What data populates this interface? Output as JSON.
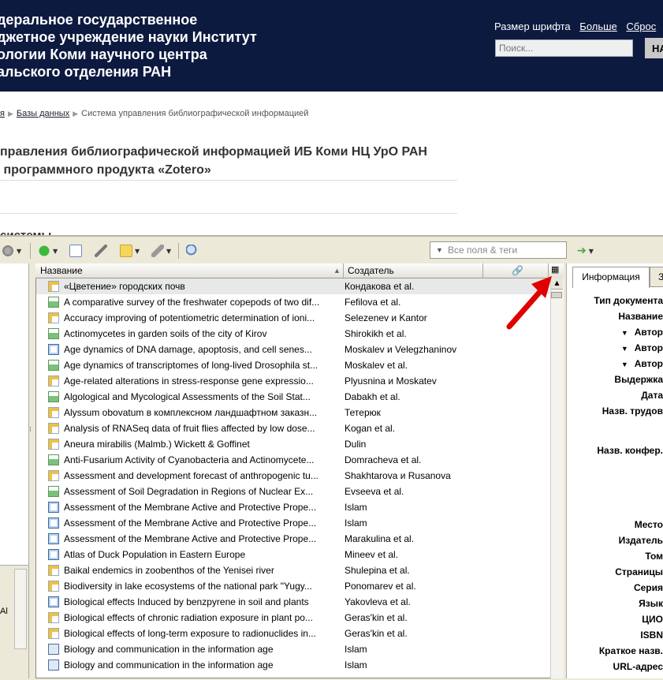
{
  "header": {
    "org_name": "деральное государственное\nджетное учреждение науки Институт\nологии Коми научного центра\nальского отделения РАН",
    "font_size_label": "Размер шрифта",
    "font_larger": "Больше",
    "font_reset": "Сброс",
    "search_placeholder": "Поиск...",
    "search_button": "НА"
  },
  "breadcrumbs": {
    "item1": "я",
    "item2": "Базы данных",
    "current": "Система управления библиографической информацией"
  },
  "page_title": "правления библиографической информацией ИБ Коми НЦ УрО РАН\n программного продукта «Zotero»",
  "section_heading": "системы",
  "toolbar": {
    "filter_placeholder": "Все поля & теги"
  },
  "columns": {
    "title": "Название",
    "creator": "Создатель"
  },
  "items": [
    {
      "title": "«Цветение» городских почв",
      "creator": "Кондакова et al.",
      "type": "article"
    },
    {
      "title": "A comparative survey of the freshwater copepods of two dif...",
      "creator": "Fefilova et al.",
      "type": "report"
    },
    {
      "title": "Accuracy improving of potentiometric determination of ioni...",
      "creator": "Selezenev и Kantor",
      "type": "article"
    },
    {
      "title": "Actinomycetes in garden soils of the city of Kirov",
      "creator": "Shirokikh et al.",
      "type": "report"
    },
    {
      "title": "Age dynamics of DNA damage, apoptosis, and cell senes...",
      "creator": "Moskalev и Velegzhaninov",
      "type": "book"
    },
    {
      "title": "Age dynamics of transcriptomes of long-lived Drosophila st...",
      "creator": "Moskalev et al.",
      "type": "report"
    },
    {
      "title": "Age-related alterations in stress-response gene expressio...",
      "creator": "Plyusnina и Moskatev",
      "type": "article"
    },
    {
      "title": "Algological and Mycological Assessments of the Soil Stat...",
      "creator": "Dabakh et al.",
      "type": "report"
    },
    {
      "title": "Alyssum obovatum в комплексном ландшафтном заказн...",
      "creator": "Тетерюк",
      "type": "article"
    },
    {
      "title": "Analysis of RNASeq data of fruit flies affected by low dose...",
      "creator": "Kogan et al.",
      "type": "article"
    },
    {
      "title": "Aneura mirabilis (Malmb.) Wickett & Goffinet",
      "creator": "Dulin",
      "type": "article"
    },
    {
      "title": "Anti-Fusarium Activity of Cyanobacteria and Actinomycete...",
      "creator": "Domracheva et al.",
      "type": "report"
    },
    {
      "title": "Assessment and development forecast of anthropogenic tu...",
      "creator": "Shakhtarova и Rusanova",
      "type": "article"
    },
    {
      "title": "Assessment of Soil Degradation in Regions of Nuclear Ex...",
      "creator": "Evseeva et al.",
      "type": "report"
    },
    {
      "title": "Assessment of the Membrane Active and Protective Prope...",
      "creator": "Islam",
      "type": "book"
    },
    {
      "title": "Assessment of the Membrane Active and Protective Prope...",
      "creator": "Islam",
      "type": "book"
    },
    {
      "title": "Assessment of the Membrane Active and Protective Prope...",
      "creator": "Marakulina et al.",
      "type": "book"
    },
    {
      "title": "Atlas of Duck Population in Eastern Europe",
      "creator": "Mineev et al.",
      "type": "book"
    },
    {
      "title": "Baikal endemics in zoobenthos of the Yenisei river",
      "creator": "Shulepina et al.",
      "type": "article"
    },
    {
      "title": "Biodiversity in lake ecosystems of the national park \"Yugy...",
      "creator": "Ponomarev et al.",
      "type": "article"
    },
    {
      "title": "Biological effects Induced by benzpyrene in soil and plants",
      "creator": "Yakovleva et al.",
      "type": "book"
    },
    {
      "title": "Biological effects of chronic radiation exposure in plant po...",
      "creator": "Geras'kin et al.",
      "type": "article"
    },
    {
      "title": "Biological effects of long-term exposure to radionuclides in...",
      "creator": "Geras'kin et al.",
      "type": "article"
    },
    {
      "title": "Biology and communication in the information age",
      "creator": "Islam",
      "type": "doc"
    },
    {
      "title": "Biology and communication in the information age",
      "creator": "Islam",
      "type": "doc"
    }
  ],
  "right_pane": {
    "tab_info": "Информация",
    "tab_other": "З",
    "fields": [
      "Тип документа",
      "Название",
      "Автор",
      "Автор",
      "Автор",
      "Выдержка",
      "Дата",
      "Назв. трудов",
      "Назв. конфер.",
      "Место",
      "Издатель",
      "Том",
      "Страницы",
      "Серия",
      "Язык",
      "ЦИО",
      "ISBN",
      "Краткое назв.",
      "URL-адрес"
    ]
  },
  "colors": {
    "header_bg": "#0d1a40",
    "chrome": "#ece9d8",
    "arrow": "#e00000"
  }
}
